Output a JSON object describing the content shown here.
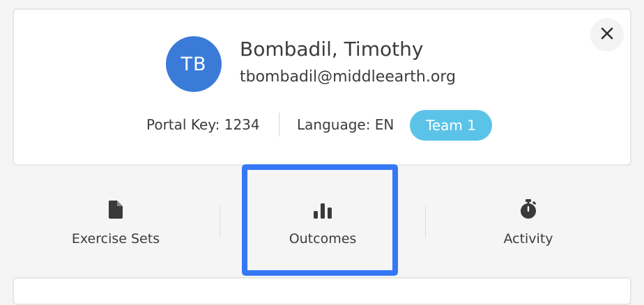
{
  "profile": {
    "initials": "TB",
    "name": "Bombadil, Timothy",
    "email": "tbombadil@middleearth.org",
    "portal_key": "Portal Key: 1234",
    "language": "Language: EN",
    "team": "Team 1",
    "avatar_color": "#3b7bd8",
    "team_color": "#5cc3e8",
    "close_icon": "close-icon"
  },
  "tabs": [
    {
      "label": "Exercise Sets",
      "icon": "document-icon"
    },
    {
      "label": "Outcomes",
      "icon": "bar-chart-icon",
      "highlighted": true
    },
    {
      "label": "Activity",
      "icon": "stopwatch-icon"
    }
  ],
  "highlight_color": "#3578f6"
}
